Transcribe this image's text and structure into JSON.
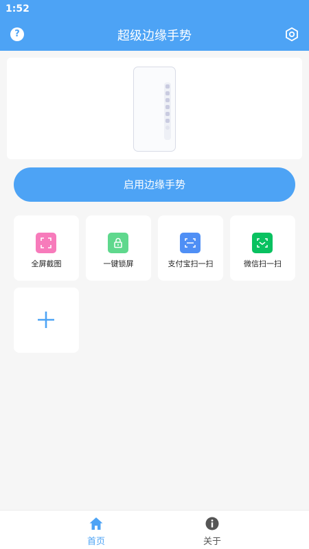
{
  "status_bar": {
    "time": "1:52"
  },
  "app_bar": {
    "title": "超级边缘手势",
    "help_icon": "help-circle-icon",
    "settings_icon": "settings-hexagon-icon"
  },
  "preview": {
    "dock_items": 7
  },
  "enable_button": {
    "label": "启用边缘手势"
  },
  "actions": [
    {
      "label": "全屏截图",
      "icon": "screenshot-icon",
      "color": "#f77bbb"
    },
    {
      "label": "一键锁屏",
      "icon": "lock-icon",
      "color": "#5fd88d"
    },
    {
      "label": "支付宝扫一扫",
      "icon": "alipay-scan-icon",
      "color": "#4f8ff5"
    },
    {
      "label": "微信扫一扫",
      "icon": "wechat-scan-icon",
      "color": "#09c160"
    }
  ],
  "add_tile": {
    "icon": "plus-icon"
  },
  "bottom_nav": [
    {
      "label": "首页",
      "icon": "home-icon",
      "active": true
    },
    {
      "label": "关于",
      "icon": "info-icon",
      "active": false
    }
  ],
  "colors": {
    "primary": "#4da3f5",
    "background": "#f6f6f6"
  }
}
